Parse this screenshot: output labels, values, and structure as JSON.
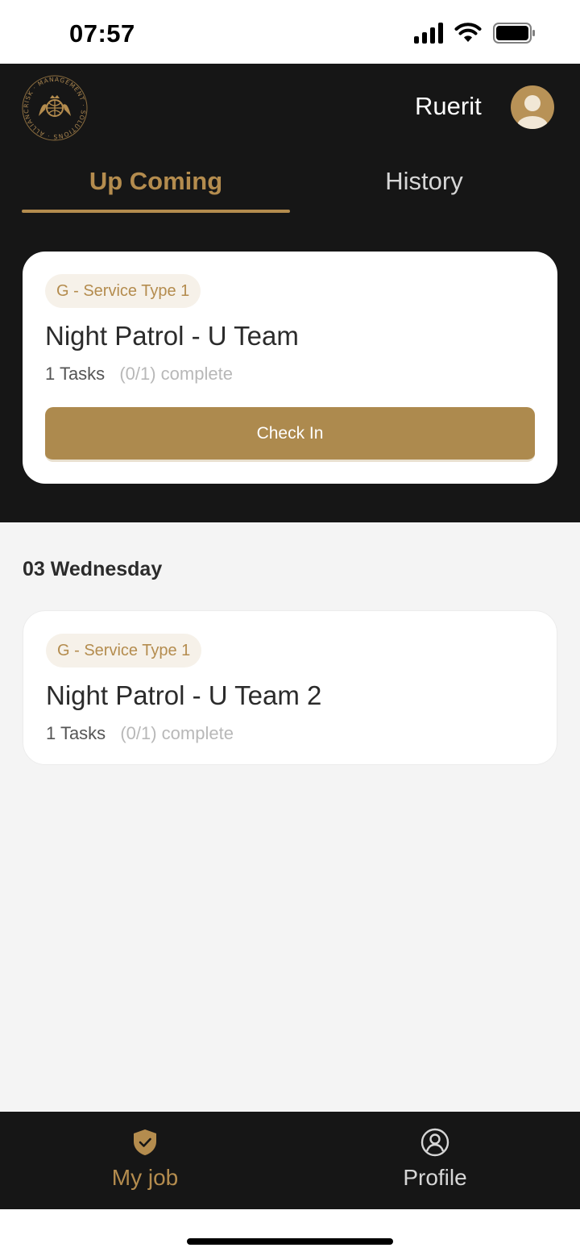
{
  "status_bar": {
    "time": "07:57",
    "icons": [
      "signal-icon",
      "wifi-icon",
      "battery-icon"
    ]
  },
  "header": {
    "logo_text": "RISK · MANAGEMENT · SOLUTIONS · ALLIANCE",
    "user_name": "Ruerit",
    "avatar_icon": "avatar-icon"
  },
  "tabs": [
    {
      "label": "Up Coming",
      "active": true
    },
    {
      "label": "History",
      "active": false
    }
  ],
  "active_job": {
    "service_type": "G - Service Type 1",
    "title": "Night Patrol - U Team",
    "tasks": "1 Tasks",
    "progress": "(0/1) complete",
    "button_label": "Check In"
  },
  "date_group": {
    "heading": "03 Wednesday",
    "jobs": [
      {
        "service_type": "G - Service Type 1",
        "title": "Night Patrol - U Team 2",
        "tasks": "1 Tasks",
        "progress": "(0/1) complete"
      }
    ]
  },
  "bottom_nav": [
    {
      "label": "My job",
      "icon": "shield-check-icon",
      "active": true
    },
    {
      "label": "Profile",
      "icon": "user-circle-icon",
      "active": false
    }
  ],
  "colors": {
    "accent": "#b48c4e",
    "button": "#ad8a4e",
    "dark": "#161616",
    "background": "#f4f4f4"
  }
}
